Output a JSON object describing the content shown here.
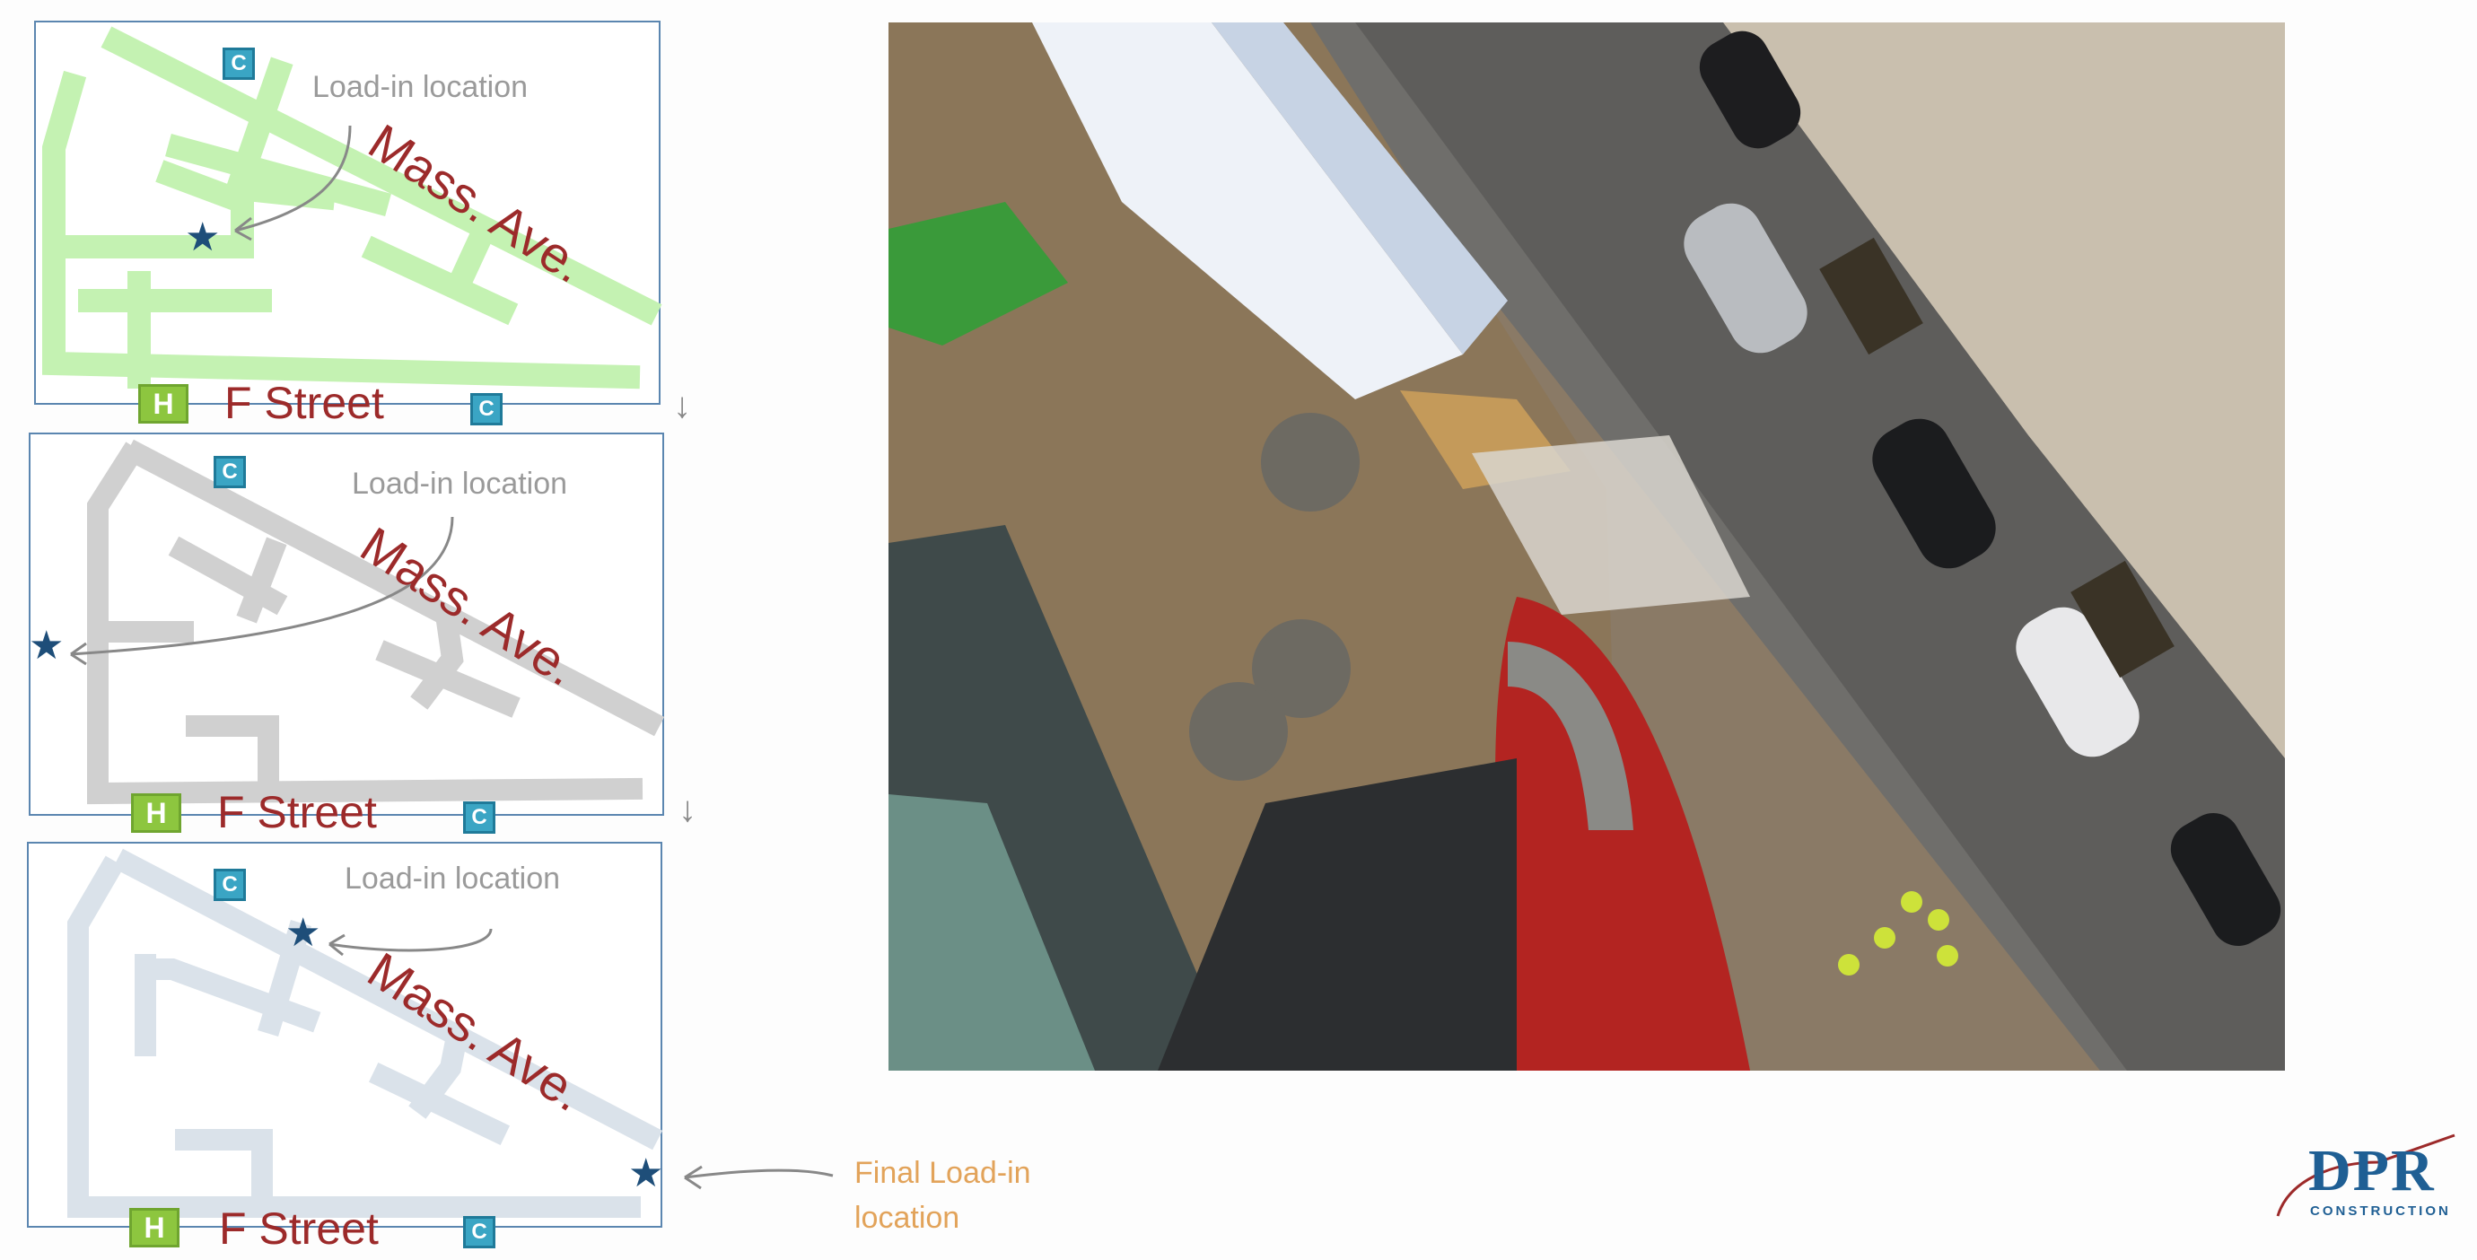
{
  "plans": [
    {
      "load_in_label": "Load-in location",
      "mass_ave": "Mass. Ave.",
      "street": "F Street",
      "h": "H",
      "c_top": "C",
      "c_bottom": "C"
    },
    {
      "load_in_label": "Load-in location",
      "mass_ave": "Mass. Ave.",
      "street": "F Street",
      "h": "H",
      "c_top": "C",
      "c_bottom": "C"
    },
    {
      "load_in_label": "Load-in location",
      "mass_ave": "Mass. Ave.",
      "street": "F Street",
      "h": "H",
      "c_top": "C",
      "c_bottom": "C"
    }
  ],
  "final_label_line1": "Final Load-in",
  "final_label_line2": "location",
  "logo": {
    "name": "DPR",
    "subtitle": "CONSTRUCTION"
  },
  "colors": {
    "accent_red": "#9c2a2a",
    "plan_green": "#bdf0a8",
    "plan_gray": "#cfcfcf",
    "plan_blue_gray": "#d8e1ea",
    "star": "#1e4e79",
    "final_label": "#e2a35a"
  },
  "icons": [
    "star-icon",
    "arrow-icon",
    "down-arrow-icon"
  ]
}
